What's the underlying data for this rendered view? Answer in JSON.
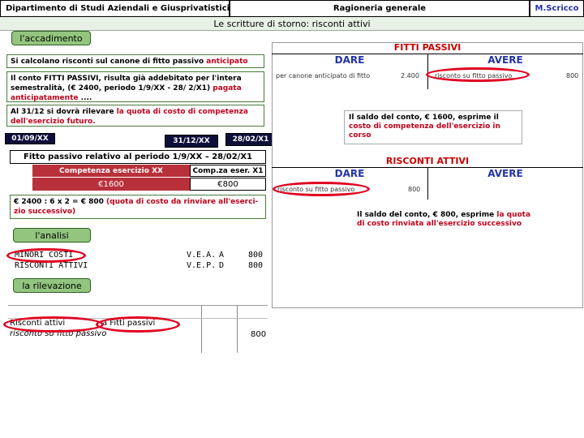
{
  "header": {
    "department": "Dipartimento di Studi Aziendali e Giusprivatistici",
    "course": "Ragioneria generale",
    "author": "M.Scricco"
  },
  "title": "Le scritture di storno: risconti attivi",
  "sections": {
    "accadimento": "l'accadimento",
    "analisi": "l'analisi",
    "rilevazione": "la rilevazione"
  },
  "text": {
    "p1_a": "Si calcolano risconti sul canone di fitto passivo ",
    "p1_b": "anticipato",
    "p2_a": "Il conto FITTI PASSIVI, risulta già addebitato per l'intera semestralità, (€ 2400, periodo 1/9/XX - 28/ 2/X1) ",
    "p2_b": "pagata anticipatamente",
    "p2_c": " ....",
    "p3_a": "Al 31/12 si dovrà rilevare ",
    "p3_b": "la quota di costo di competenza dell'esercizio futuro."
  },
  "timeline": {
    "d1": "01/09/XX",
    "d2": "31/12/XX",
    "d3": "28/02/X1"
  },
  "split": {
    "title": "Fitto passivo relativo al periodo 1/9/XX – 28/02/X1",
    "left_label": "Competenza esercizio XX",
    "right_label": "Comp.za eser. X1",
    "left_value": "€1600",
    "right_value": "€800"
  },
  "calc": {
    "a": "€ 2400 : 6 x 2 = € 800 ",
    "b": "(quota di costo da rinviare all'eserci-zio successivo)"
  },
  "analysis": {
    "rows": [
      {
        "account": "MINORI COSTI",
        "type": "V.E.A.",
        "side": "A",
        "amount": "800"
      },
      {
        "account": "RISCONTI ATTIVI",
        "type": "V.E.P.",
        "side": "D",
        "amount": "800"
      }
    ]
  },
  "journal": {
    "debit": "Risconti attivi",
    "credit": "a Fitti passivi",
    "description": "risconto su fitto passivo",
    "amount": "800"
  },
  "t_accounts": {
    "fitti": {
      "title": "FITTI PASSIVI",
      "dare": "DARE",
      "avere": "AVERE",
      "debit_desc": "per canone anticipato di fitto",
      "debit_amount": "2.400",
      "credit_desc": "risconto su fitto passivo",
      "credit_amount": "800"
    },
    "risconti": {
      "title": "RISCONTI ATTIVI",
      "dare": "DARE",
      "avere": "AVERE",
      "debit_desc": "risconto su fitto passivo",
      "debit_amount": "800"
    }
  },
  "notes": {
    "n1_a": "Il saldo del conto, € 1600, esprime il ",
    "n1_b": "costo di competenza dell'esercizio in corso",
    "n2_a": "Il saldo del conto, € 800, esprime ",
    "n2_b": "la quota di costo rinviata all'esercizio successivo"
  },
  "colors": {
    "accent_red": "#c0001a",
    "section_green": "#93c57f",
    "dark_box": "#0e0e3a",
    "account_blue": "#2233aa"
  }
}
